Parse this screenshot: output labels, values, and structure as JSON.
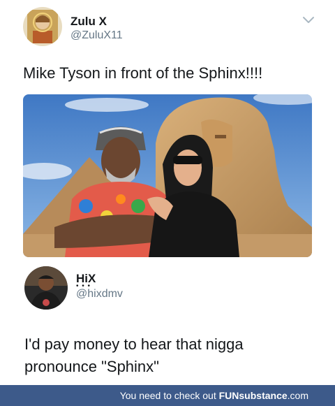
{
  "tweet1": {
    "name": "Zulu X",
    "handle": "@ZuluX11",
    "text": "Mike Tyson in front of the Sphinx!!!!"
  },
  "tweet2": {
    "name": "HiX",
    "handle": "@hixdmv",
    "text_line1": "I'd pay money to hear that nigga",
    "text_line2": "pronounce \"Sphinx\""
  },
  "footer": {
    "prefix": "You need to check out ",
    "brand": "FUNsubstance",
    "suffix": ".com"
  },
  "icons": {
    "menu": "chevron-down-icon"
  },
  "colors": {
    "footer_bg": "#3d5a8a",
    "handle": "#657786",
    "text": "#14171a"
  }
}
